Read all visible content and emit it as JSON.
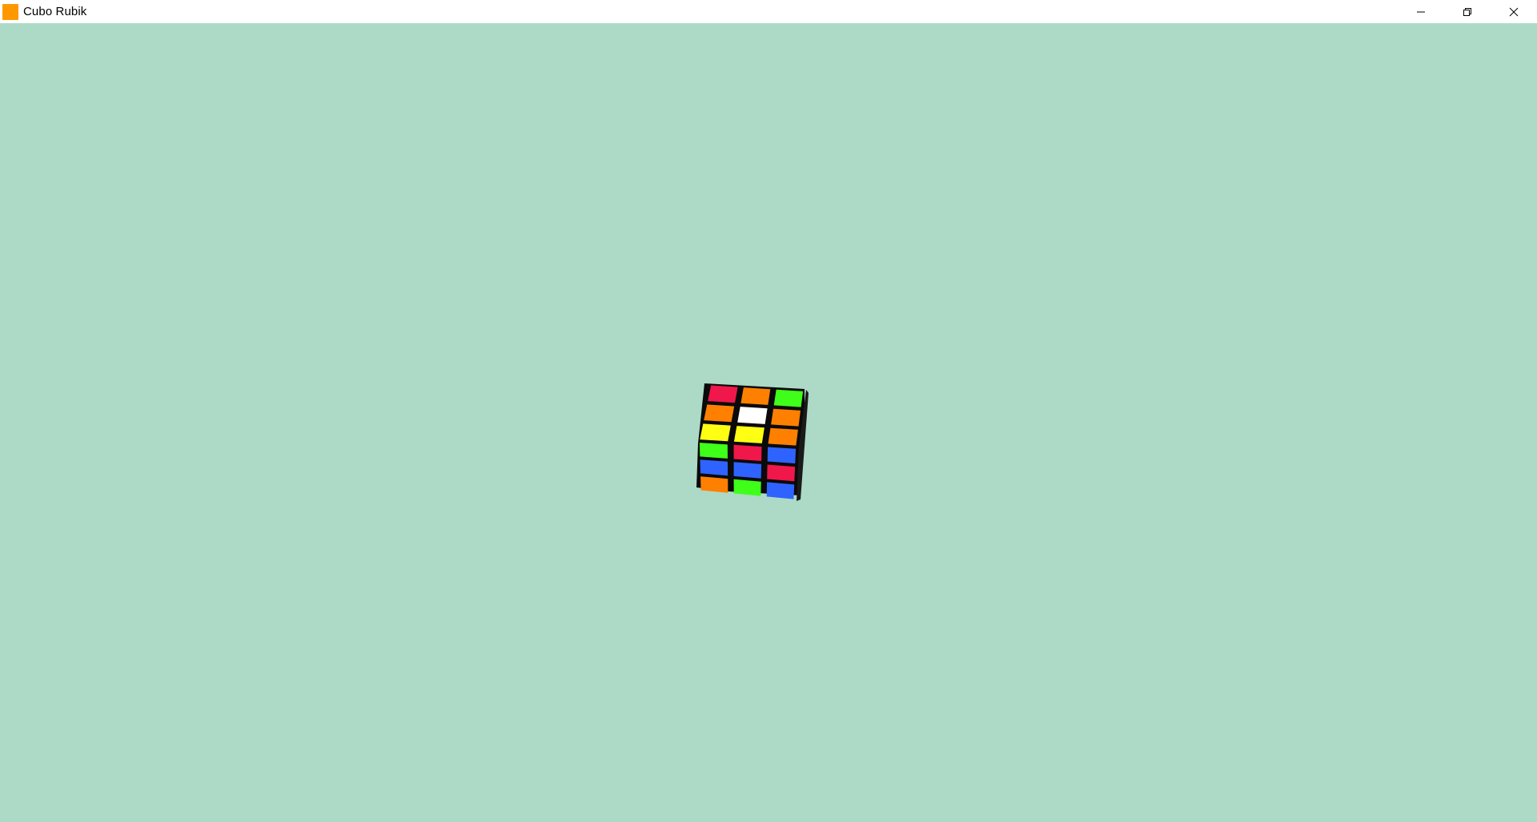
{
  "window": {
    "title": "Cubo Rubik",
    "icon": "app-square-icon",
    "background": "#acdac7",
    "controls": [
      {
        "name": "minimize-button",
        "icon": "minimize-icon"
      },
      {
        "name": "restore-button",
        "icon": "restore-icon"
      },
      {
        "name": "close-button",
        "icon": "close-icon"
      }
    ]
  },
  "colors": {
    "red": "#f0174a",
    "orange": "#ff8000",
    "green": "#3fff1a",
    "white": "#ffffff",
    "yellow": "#ffff14",
    "blue": "#2f63ff",
    "frame": "#0a0a0a"
  },
  "cube": {
    "top_face": [
      [
        "red",
        "orange",
        "green"
      ],
      [
        "orange",
        "white",
        "orange"
      ],
      [
        "yellow",
        "yellow",
        "orange"
      ]
    ],
    "front_face": [
      [
        "green",
        "red",
        "blue"
      ],
      [
        "blue",
        "blue",
        "red"
      ],
      [
        "orange",
        "green",
        "blue"
      ]
    ]
  }
}
